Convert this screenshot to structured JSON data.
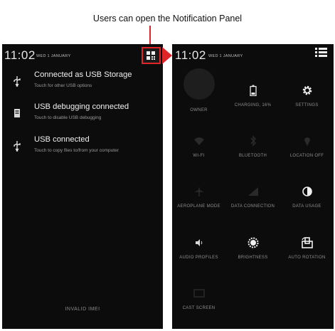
{
  "caption": "Users can open the Notification Panel",
  "left_screen": {
    "time": "11:02",
    "date": "WED 1 JANUARY",
    "notifications": [
      {
        "icon": "usb-icon",
        "title": "Connected as USB Storage",
        "subtitle": "Touch for other USB options"
      },
      {
        "icon": "sd-card-icon",
        "title": "USB debugging connected",
        "subtitle": "Touch to disable USB debugging"
      },
      {
        "icon": "usb-icon",
        "title": "USB connected",
        "subtitle": "Touch to copy files to/from your computer"
      }
    ],
    "carrier": "INVALID IMEI"
  },
  "right_screen": {
    "time": "11:02",
    "date": "WED 1 JANUARY",
    "tiles": [
      {
        "icon": "owner-icon",
        "label": "OWNER",
        "active": false
      },
      {
        "icon": "battery-icon",
        "label": "CHARGING, 16%",
        "active": true
      },
      {
        "icon": "gear-icon",
        "label": "SETTINGS",
        "active": true
      },
      {
        "icon": "wifi-icon",
        "label": "WI-FI",
        "active": false
      },
      {
        "icon": "bluetooth-icon",
        "label": "BLUETOOTH",
        "active": false
      },
      {
        "icon": "location-icon",
        "label": "LOCATION OFF",
        "active": false
      },
      {
        "icon": "airplane-icon",
        "label": "AEROPLANE MODE",
        "active": false
      },
      {
        "icon": "data-icon",
        "label": "DATA CONNECTION",
        "active": false
      },
      {
        "icon": "brightness-contrast-icon",
        "label": "DATA USAGE",
        "active": true
      },
      {
        "icon": "speaker-icon",
        "label": "AUDIO PROFILES",
        "active": true
      },
      {
        "icon": "brightness-icon",
        "label": "BRIGHTNESS",
        "active": true
      },
      {
        "icon": "rotate-icon",
        "label": "AUTO ROTATION",
        "active": true
      },
      {
        "icon": "cast-icon",
        "label": "CAST SCREEN",
        "active": false
      }
    ]
  },
  "colors": {
    "highlight": "#e02528",
    "screen_bg": "#0c0c0c",
    "text_primary": "#f1f1f1",
    "text_secondary": "#9a9a9a"
  }
}
